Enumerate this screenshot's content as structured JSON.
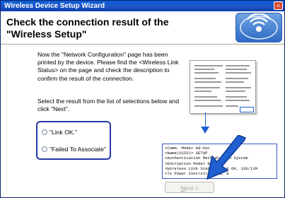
{
  "window": {
    "title": "Wireless Device Setup Wizard",
    "close_label": "×"
  },
  "header": {
    "line1": "Check the connection result of the",
    "line2": "\"Wireless Setup\""
  },
  "body": {
    "paragraph1": "Now the \"Network Configuration\" page has been printed by the device. Please find the <Wireless Link Status> on the page and check the description to confirm the result of the connection.",
    "paragraph2": "Select the result from the list of selections below and click \"Next\"."
  },
  "options": [
    {
      "label": "\"Link OK.\"",
      "selected": false
    },
    {
      "label": "\"Failed To Associate\"",
      "selected": false
    }
  ],
  "zoom_lines": [
    "<Comm. Mode>            Ad-hoc",
    "<Name(SSID)>            SETUP",
    "<Authentication Method> Open System",
    "<Encryption Mode>       None",
    "<Wireless Link Status>  Link OK, 11b/11M",
    "<Tx Power Control>      0N, 1, 0"
  ],
  "footer": {
    "next_prefix": "N",
    "next_rest": "ext >",
    "next_enabled": false
  },
  "colors": {
    "title_bar": "#1f55c5",
    "accent": "#2060d0",
    "window_bg": "#ece9d8"
  }
}
